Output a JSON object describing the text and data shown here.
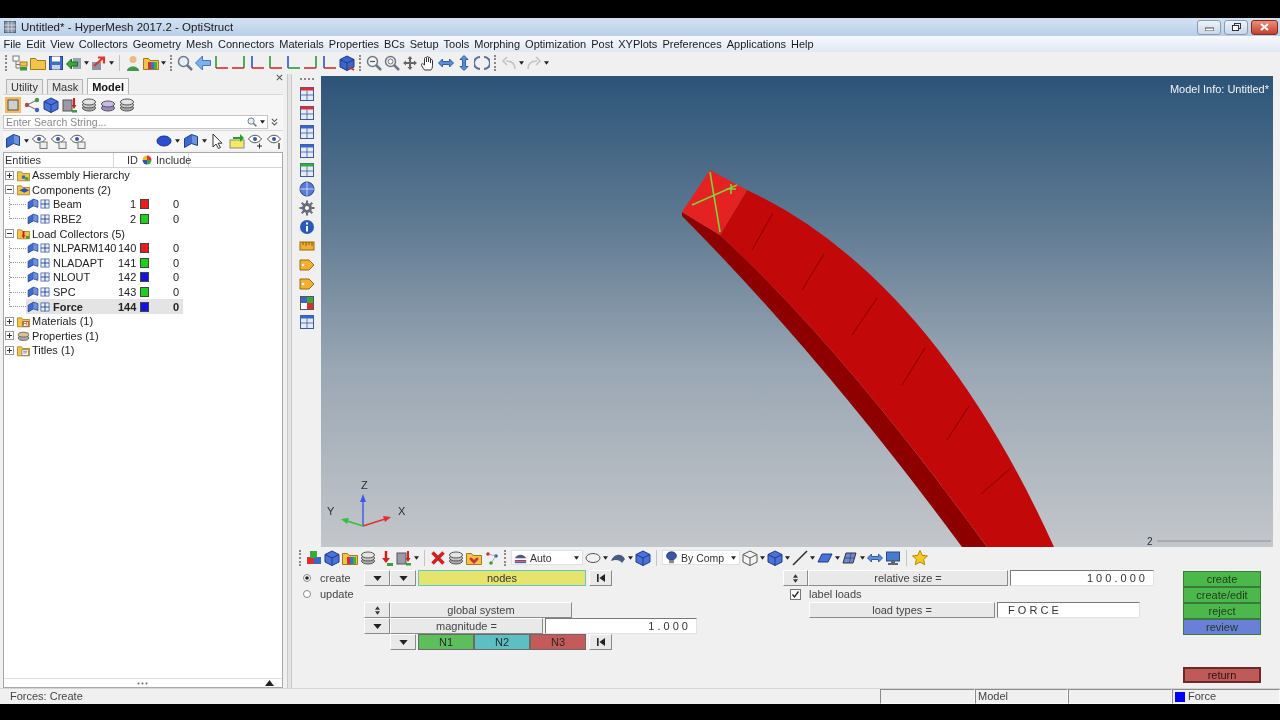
{
  "window": {
    "title": "Untitled* - HyperMesh 2017.2 - OptiStruct"
  },
  "menu": [
    "File",
    "Edit",
    "View",
    "Collectors",
    "Geometry",
    "Mesh",
    "Connectors",
    "Materials",
    "Properties",
    "BCs",
    "Setup",
    "Tools",
    "Morphing",
    "Optimization",
    "Post",
    "XYPlots",
    "Preferences",
    "Applications",
    "Help"
  ],
  "browser": {
    "tabs": [
      {
        "label": "Utility",
        "selected": false
      },
      {
        "label": "Mask",
        "selected": false
      },
      {
        "label": "Model",
        "selected": true
      }
    ],
    "search": {
      "placeholder": "Enter Search String..."
    },
    "columns": {
      "entities": "Entities",
      "id": "ID",
      "include": "Include"
    },
    "tree": [
      {
        "label": "Assembly Hierarchy",
        "kind": "assembly",
        "expanded": false
      },
      {
        "label": "Components (2)",
        "kind": "components",
        "expanded": true,
        "children": [
          {
            "name": "Beam",
            "id": "1",
            "color": "#e81c1c",
            "include": "0",
            "selected": false
          },
          {
            "name": "RBE2",
            "id": "2",
            "color": "#1cd01c",
            "include": "0",
            "selected": false
          }
        ]
      },
      {
        "label": "Load Collectors (5)",
        "kind": "loadcols",
        "expanded": true,
        "children": [
          {
            "name": "NLPARM140",
            "id": "140",
            "color": "#e81c1c",
            "include": "0",
            "selected": false
          },
          {
            "name": "NLADAPT",
            "id": "141",
            "color": "#1cd01c",
            "include": "0",
            "selected": false
          },
          {
            "name": "NLOUT",
            "id": "142",
            "color": "#1414e0",
            "include": "0",
            "selected": false
          },
          {
            "name": "SPC",
            "id": "143",
            "color": "#1cd01c",
            "include": "0",
            "selected": false
          },
          {
            "name": "Force",
            "id": "144",
            "color": "#1414e0",
            "include": "0",
            "selected": true
          }
        ]
      },
      {
        "label": "Materials (1)",
        "kind": "materials",
        "expanded": false
      },
      {
        "label": "Properties (1)",
        "kind": "properties",
        "expanded": false
      },
      {
        "label": "Titles (1)",
        "kind": "titles",
        "expanded": false
      }
    ]
  },
  "viewport": {
    "model_info": "Model Info: Untitled*",
    "axes": {
      "z": "Z",
      "y": "Y",
      "x": "X"
    },
    "scale_label": "2"
  },
  "view_toolbar": {
    "display_mode": "Auto",
    "color_mode": "By Comp"
  },
  "forces_panel": {
    "modes": [
      {
        "label": "create",
        "selected": true
      },
      {
        "label": "update",
        "selected": false
      }
    ],
    "entity_selector": "nodes",
    "system": "global system",
    "magnitude": {
      "label": "magnitude =",
      "value": "1 . 0 0 0"
    },
    "directions": [
      {
        "label": "N1",
        "color": "#5cbf5c"
      },
      {
        "label": "N2",
        "color": "#5bbfc4"
      },
      {
        "label": "N3",
        "color": "#c45a5a"
      }
    ],
    "relative_size": {
      "label": "relative size =",
      "value": "1 0 0 . 0 0 0"
    },
    "label_loads": {
      "label": "label loads",
      "checked": true
    },
    "load_types": {
      "label": "load types =",
      "value": "F O R C E"
    },
    "actions": [
      {
        "label": "create",
        "color": "#4cb84c"
      },
      {
        "label": "create/edit",
        "color": "#4cb84c"
      },
      {
        "label": "reject",
        "color": "#4cb84c"
      },
      {
        "label": "review",
        "color": "#6a80d8"
      }
    ],
    "return_label": "return"
  },
  "status_bar": {
    "message": "Forces: Create",
    "model": "Model",
    "collector": {
      "name": "Force",
      "color": "#0000ff"
    }
  }
}
